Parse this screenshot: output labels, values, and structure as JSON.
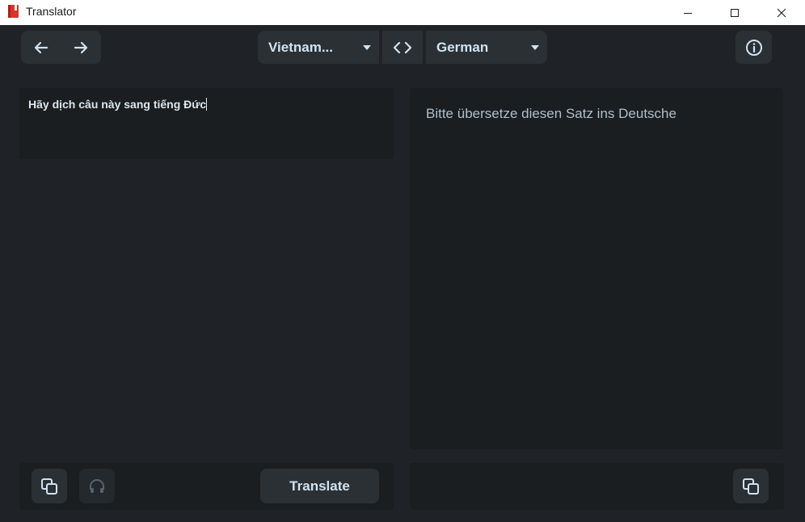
{
  "window": {
    "title": "Translator"
  },
  "toolbar": {
    "back_icon": "arrow-left-icon",
    "forward_icon": "arrow-right-icon",
    "source_language": "Vietnam...",
    "target_language": "German",
    "swap_icon": "code-brackets-icon",
    "info_icon": "info-circle-icon"
  },
  "source": {
    "text": "Hãy dịch câu này sang tiếng Đức"
  },
  "target": {
    "text": "Bitte übersetze diesen Satz ins Deutsche"
  },
  "bottom": {
    "translate_label": "Translate",
    "copy_icon": "copy-icon",
    "listen_icon": "headphones-icon"
  },
  "colors": {
    "background": "#1f2327",
    "panel": "#1a1e21",
    "button": "#2b3035",
    "accent_text": "#cfe3f0"
  }
}
